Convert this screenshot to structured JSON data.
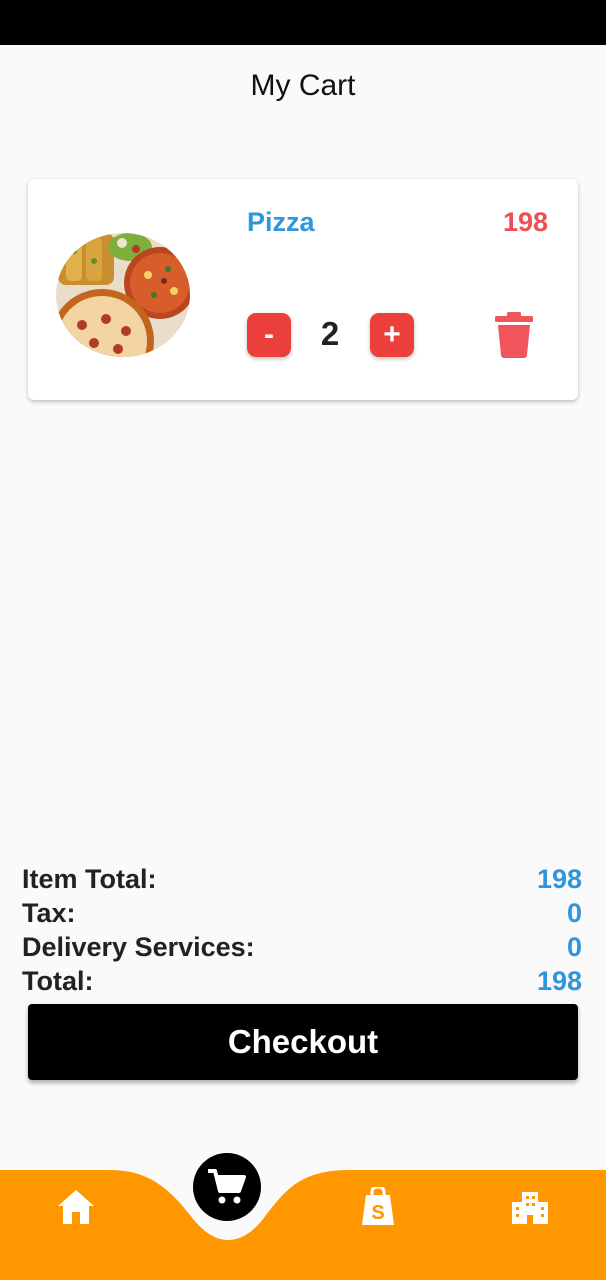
{
  "app_bar": {
    "title": "My Cart"
  },
  "cart": {
    "items": [
      {
        "name": "Pizza",
        "price": "198",
        "quantity": "2",
        "decrement_label": "-",
        "increment_label": "+",
        "image_icon": "pizza-photo",
        "delete_icon": "trash-icon"
      }
    ]
  },
  "summary": {
    "item_total_label": "Item Total:",
    "item_total_value": "198",
    "tax_label": "Tax:",
    "tax_value": "0",
    "delivery_label": "Delivery Services:",
    "delivery_value": "0",
    "total_label": "Total:",
    "total_value": "198"
  },
  "checkout": {
    "label": "Checkout"
  },
  "bottom_nav": {
    "items": [
      {
        "icon": "home-icon"
      },
      {
        "icon": "cart-icon",
        "active": true
      },
      {
        "icon": "shopping-bag-icon"
      },
      {
        "icon": "city-icon"
      }
    ]
  },
  "colors": {
    "accent_blue": "#2f95dc",
    "price_red": "#ee4f55",
    "button_red": "#ea3f3a",
    "nav_orange": "#ff9800"
  }
}
